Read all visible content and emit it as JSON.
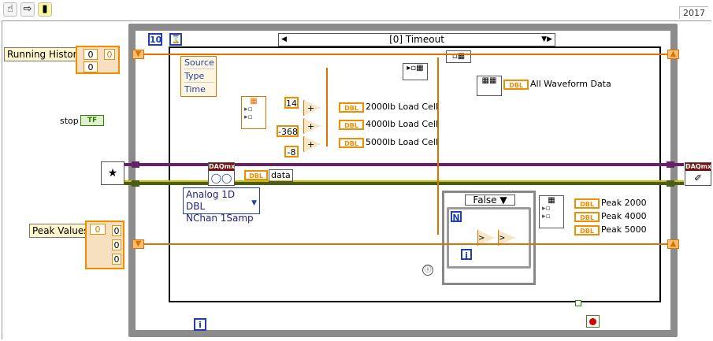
{
  "toolbar": {
    "year": "2017",
    "icons": [
      "hand-icon",
      "arrow-right-icon",
      "highlight-run-icon"
    ]
  },
  "controls": {
    "running_history": {
      "label": "Running History",
      "value1": "0",
      "value2": "0",
      "index": "0"
    },
    "stop": {
      "label": "stop",
      "value": "TF"
    },
    "peak_values": {
      "label": "Peak Values",
      "index": "0",
      "values": [
        "0",
        "0",
        "0"
      ]
    }
  },
  "loop": {
    "count_label": "10",
    "iteration": "i",
    "case_selector": "[0] Timeout",
    "inner_case_selector": "False",
    "for_count": "N",
    "for_iter": "i"
  },
  "unbundle": {
    "items": [
      "Source",
      "Type",
      "Time"
    ]
  },
  "constants": {
    "c1": "14",
    "c2": "-368",
    "c3": "-8"
  },
  "indicators": {
    "load2000": "2000lb Load Cell",
    "load4000": "4000lb Load Cell",
    "load5000": "5000lb Load Cell",
    "all_wave": "All Waveform Data",
    "data": "data",
    "peak2000": "Peak 2000",
    "peak4000": "Peak 4000",
    "peak5000": "Peak 5000",
    "dbl": "DBL"
  },
  "daqmx": {
    "polymorph": "Analog 1D DBL\nNChan 1Samp",
    "line1": "Analog 1D DBL",
    "line2": "NChan 1Samp",
    "badge": "DAQmx"
  },
  "colors": {
    "numeric": "#e07000",
    "boolean": "#2e7d00",
    "task": "#6b1f6b",
    "error": "#c9c000",
    "string": "#e600e6"
  }
}
